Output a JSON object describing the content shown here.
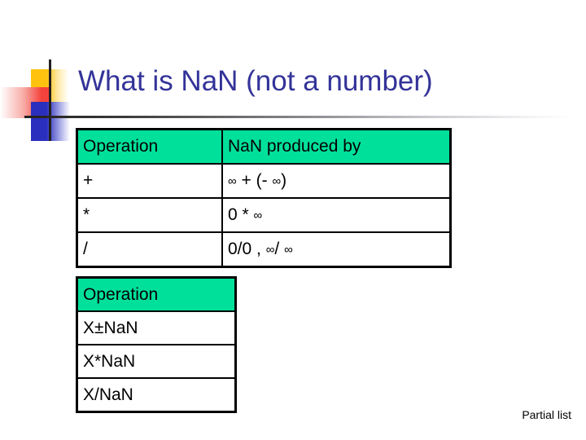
{
  "slide": {
    "title": "What is NaN (not a number)",
    "title_color": "#333399",
    "footnote": "Partial list",
    "accent_header_color": "#00e09b",
    "deco": {
      "yellow": "#ffc20e",
      "red": "#f4433c",
      "blue": "#2b2fbd",
      "line": "#231f20"
    }
  },
  "table_operations": {
    "headers": [
      "Operation",
      "NaN produced by"
    ],
    "rows": [
      {
        "operation": "+",
        "produced_by_pre": "",
        "produced_by": "∞ + (- ∞)"
      },
      {
        "operation": "*",
        "produced_by": "0 * ∞"
      },
      {
        "operation": "/",
        "produced_by": "0/0 , ∞/ ∞"
      }
    ]
  },
  "table_nan_ops": {
    "headers": [
      "Operation"
    ],
    "rows": [
      {
        "operation": "X±NaN"
      },
      {
        "operation": "X*NaN"
      },
      {
        "operation": "X/NaN"
      }
    ]
  }
}
